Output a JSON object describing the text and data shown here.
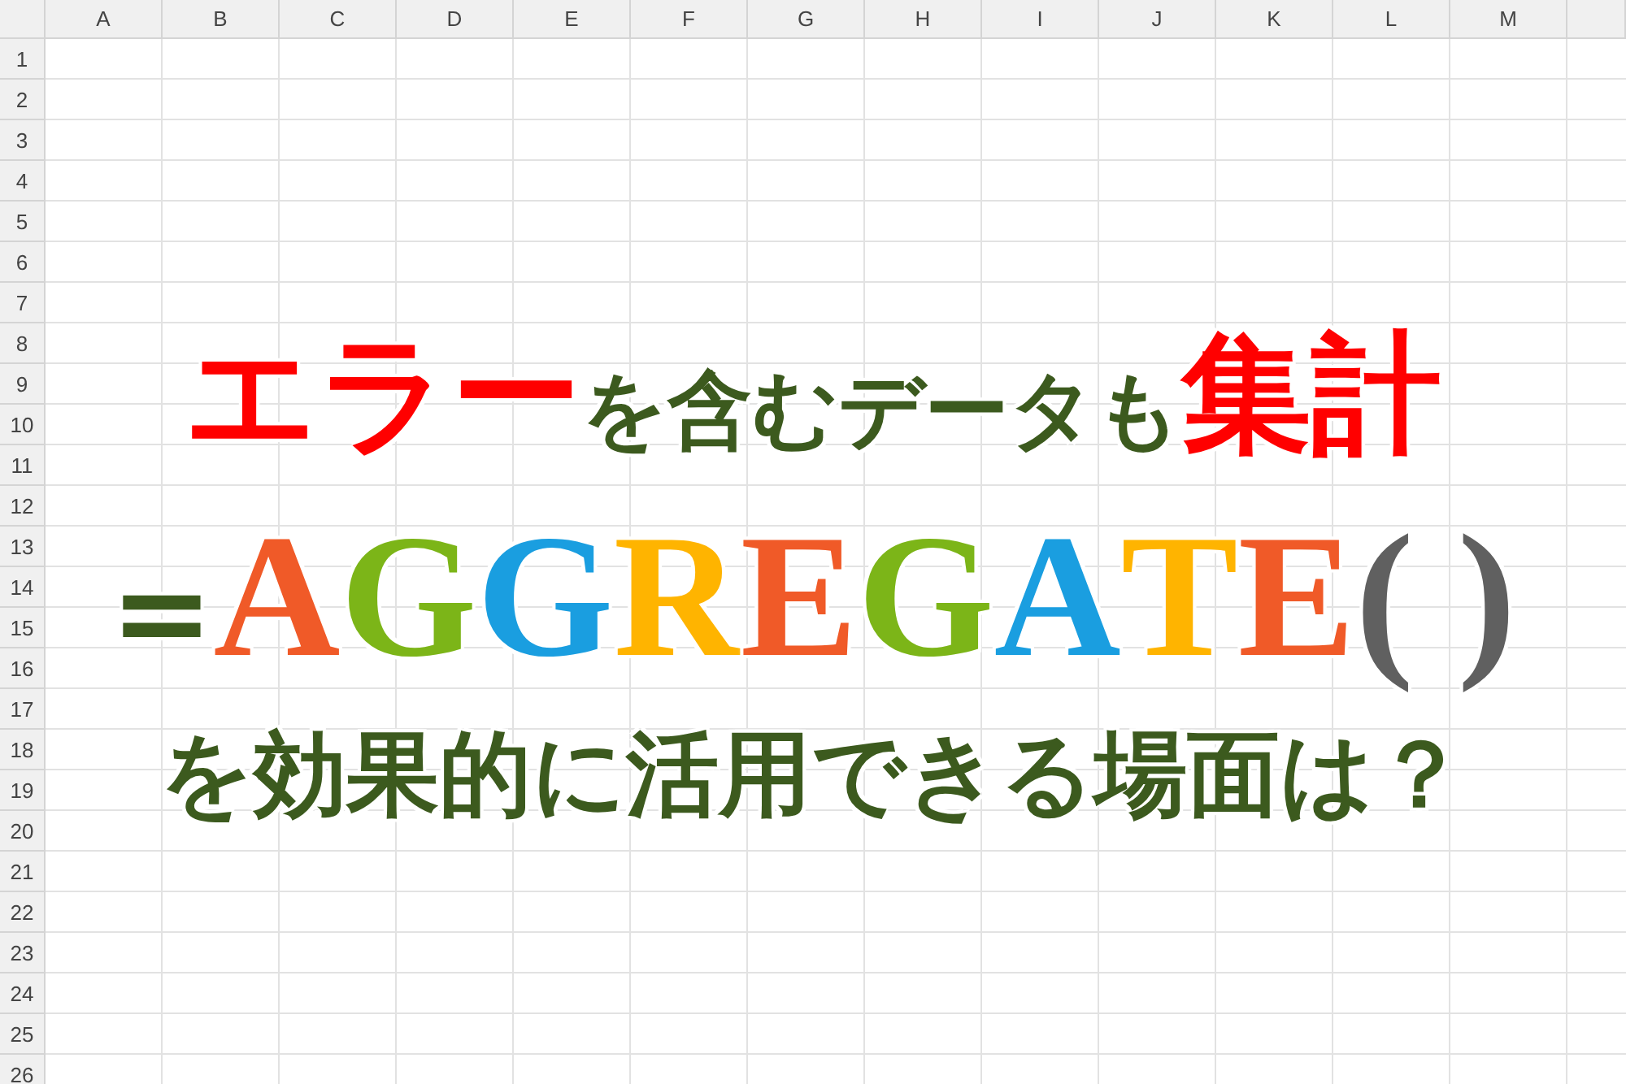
{
  "sheet": {
    "columns": [
      "A",
      "B",
      "C",
      "D",
      "E",
      "F",
      "G",
      "H",
      "I",
      "J",
      "K",
      "L",
      "M"
    ],
    "rows": [
      "1",
      "2",
      "3",
      "4",
      "5",
      "6",
      "7",
      "8",
      "9",
      "10",
      "11",
      "12",
      "13",
      "14",
      "15",
      "16",
      "17",
      "18",
      "19",
      "20",
      "21",
      "22",
      "23",
      "24",
      "25",
      "26"
    ]
  },
  "headline": [
    {
      "kind": "mixed",
      "segments": [
        {
          "text": "エラー",
          "color": "#ff0000",
          "kind": "emphasis"
        },
        {
          "text": "を含むデータも",
          "color": "#3c5a1e",
          "kind": "body"
        },
        {
          "text": "集計",
          "color": "#ff0000",
          "kind": "emphasis"
        }
      ]
    },
    {
      "kind": "formula",
      "segments": [
        {
          "text": "=",
          "color": "#3c5a1e"
        },
        {
          "text": "A",
          "color": "#f05a28"
        },
        {
          "text": "G",
          "color": "#7cb518"
        },
        {
          "text": "G",
          "color": "#1a9ee0"
        },
        {
          "text": "R",
          "color": "#ffb400"
        },
        {
          "text": "E",
          "color": "#f05a28"
        },
        {
          "text": "G",
          "color": "#7cb518"
        },
        {
          "text": "A",
          "color": "#1a9ee0"
        },
        {
          "text": "T",
          "color": "#ffb400"
        },
        {
          "text": "E",
          "color": "#f05a28"
        },
        {
          "text": "( )",
          "color": "#606060"
        }
      ]
    },
    {
      "kind": "plain",
      "segments": [
        {
          "text": "を効果的に活用できる場面は？",
          "color": "#3c5a1e",
          "kind": "body"
        }
      ]
    }
  ]
}
